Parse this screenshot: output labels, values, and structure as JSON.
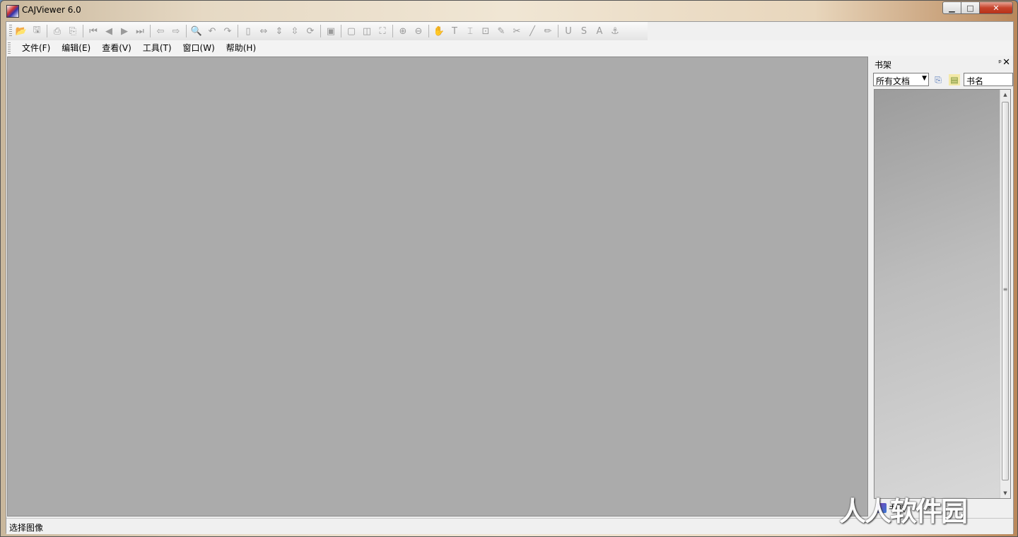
{
  "window": {
    "title": "CAJViewer 6.0",
    "minimize": "▁",
    "maximize": "□",
    "close": "✕"
  },
  "menu": [
    "文件(F)",
    "编辑(E)",
    "查看(V)",
    "工具(T)",
    "窗口(W)",
    "帮助(H)"
  ],
  "toolbar": {
    "groups": [
      [
        {
          "icon": "open-folder-icon",
          "glyph": "📂",
          "active": true
        },
        {
          "icon": "save-icon",
          "glyph": "🖫"
        }
      ],
      [
        {
          "icon": "print-icon",
          "glyph": "⎙"
        },
        {
          "icon": "print-preview-icon",
          "glyph": "⎘"
        }
      ],
      [
        {
          "icon": "first-page-icon",
          "glyph": "⏮"
        },
        {
          "icon": "prev-page-icon",
          "glyph": "◀"
        },
        {
          "icon": "next-page-icon",
          "glyph": "▶"
        },
        {
          "icon": "last-page-icon",
          "glyph": "⏭"
        }
      ],
      [
        {
          "icon": "back-icon",
          "glyph": "⇦"
        },
        {
          "icon": "forward-icon",
          "glyph": "⇨"
        }
      ],
      [
        {
          "icon": "find-icon",
          "glyph": "🔍",
          "search": true
        },
        {
          "icon": "undo-icon",
          "glyph": "↶"
        },
        {
          "icon": "redo-icon",
          "glyph": "↷"
        }
      ],
      [
        {
          "icon": "single-page-icon",
          "glyph": "▯"
        },
        {
          "icon": "fit-width-icon",
          "glyph": "⇔"
        },
        {
          "icon": "fit-height-icon",
          "glyph": "⇕"
        },
        {
          "icon": "continuous-icon",
          "glyph": "⇳"
        },
        {
          "icon": "rotate-icon",
          "glyph": "⟳"
        }
      ],
      [
        {
          "icon": "image-icon",
          "glyph": "▣"
        }
      ],
      [
        {
          "icon": "page-icon",
          "glyph": "▢"
        },
        {
          "icon": "two-page-icon",
          "glyph": "◫"
        },
        {
          "icon": "full-screen-icon",
          "glyph": "⛶"
        }
      ],
      [
        {
          "icon": "zoom-in-icon",
          "glyph": "⊕"
        },
        {
          "icon": "zoom-out-icon",
          "glyph": "⊖"
        }
      ],
      [
        {
          "icon": "hand-icon",
          "glyph": "✋"
        },
        {
          "icon": "select-text-icon",
          "glyph": "T"
        },
        {
          "icon": "select-region-icon",
          "glyph": "⌶"
        },
        {
          "icon": "select-image-icon",
          "glyph": "⊡"
        },
        {
          "icon": "ocr-icon",
          "glyph": "✎"
        },
        {
          "icon": "snapshot-icon",
          "glyph": "✂"
        },
        {
          "icon": "line-icon",
          "glyph": "╱"
        },
        {
          "icon": "pencil-icon",
          "glyph": "✏"
        }
      ],
      [
        {
          "icon": "underline-icon",
          "glyph": "U"
        },
        {
          "icon": "strikeout-icon",
          "glyph": "S"
        },
        {
          "icon": "highlight-icon",
          "glyph": "A"
        },
        {
          "icon": "anchor-icon",
          "glyph": "⚓"
        }
      ]
    ]
  },
  "panel": {
    "title": "书架",
    "pin": "ᵖ",
    "close": "✕",
    "filter_value": "所有文档",
    "sort_field": "书名",
    "tabs": [
      "书架",
      "标"
    ]
  },
  "status": {
    "text": "选择图像"
  },
  "watermark": "人人软件园"
}
